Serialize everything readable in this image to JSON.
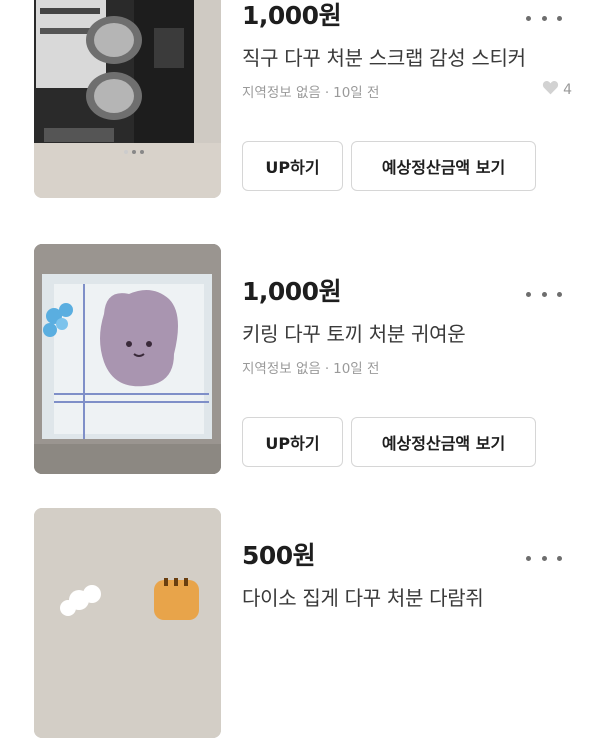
{
  "listings": [
    {
      "price": "1,000원",
      "title": "직구 다꾸 처분 스크랩 감성 스티커",
      "location": "지역정보 없음",
      "separator": "·",
      "time": "10일 전",
      "likes": "4",
      "up_button": "UP하기",
      "settle_button": "예상정산금액 보기"
    },
    {
      "price": "1,000원",
      "title": "키링 다꾸 토끼 처분 귀여운",
      "location": "지역정보 없음",
      "separator": "·",
      "time": "10일 전",
      "up_button": "UP하기",
      "settle_button": "예상정산금액 보기"
    },
    {
      "price": "500원",
      "title": "다이소 집게 다꾸 처분 다람쥐"
    }
  ],
  "colors": {
    "text": "#1e1e1e",
    "muted": "#9a9a9a",
    "border": "#d6d6d6"
  },
  "icons": [
    "more-options-icon",
    "heart-icon"
  ]
}
